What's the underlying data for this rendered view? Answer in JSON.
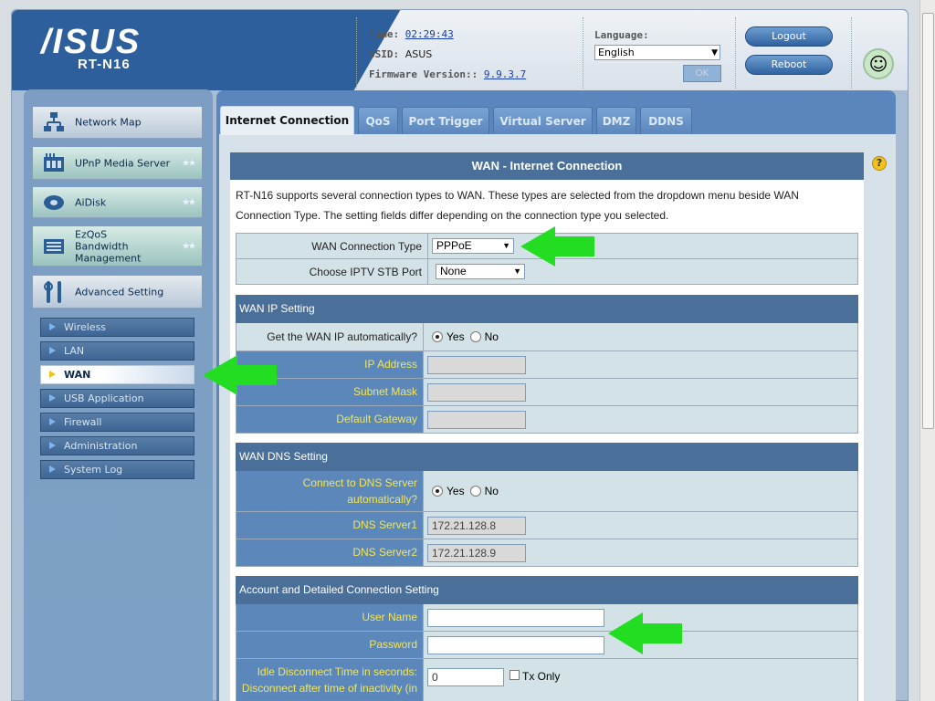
{
  "header": {
    "logo": "/ISUS",
    "model": "RT-N16",
    "time_label": "Time:",
    "time_value": "02:29:43",
    "ssid_label": "SSID:",
    "ssid_value": "ASUS",
    "firmware_label": "Firmware Version::",
    "firmware_value": "9.9.3.7",
    "language_label": "Language:",
    "language_value": "English",
    "ok_label": "OK",
    "logout_label": "Logout",
    "reboot_label": "Reboot"
  },
  "sidebar": {
    "main_items": [
      {
        "label": "Network Map"
      },
      {
        "label": "UPnP Media Server"
      },
      {
        "label": "AiDisk"
      },
      {
        "label": "EzQoS Bandwidth Management"
      },
      {
        "label": "Advanced Setting"
      }
    ],
    "sub_items": [
      {
        "label": "Wireless"
      },
      {
        "label": "LAN"
      },
      {
        "label": "WAN"
      },
      {
        "label": "USB Application"
      },
      {
        "label": "Firewall"
      },
      {
        "label": "Administration"
      },
      {
        "label": "System Log"
      }
    ]
  },
  "tabs": [
    "Internet Connection",
    "QoS",
    "Port Trigger",
    "Virtual Server",
    "DMZ",
    "DDNS"
  ],
  "panel": {
    "title": "WAN - Internet Connection",
    "description": "RT-N16 supports several connection types to WAN. These types are selected from the dropdown menu beside WAN Connection Type. The setting fields differ depending on the connection type you selected.",
    "wan_connection_type_label": "WAN Connection Type",
    "wan_connection_type_value": "PPPoE",
    "iptv_label": "Choose IPTV STB Port",
    "iptv_value": "None",
    "wan_ip_section": "WAN IP Setting",
    "get_ip_auto_label": "Get the WAN IP automatically?",
    "yes_label": "Yes",
    "no_label": "No",
    "ip_address_label": "IP Address",
    "subnet_mask_label": "Subnet Mask",
    "default_gateway_label": "Default Gateway",
    "wan_dns_section": "WAN DNS Setting",
    "dns_auto_label": "Connect to DNS Server automatically?",
    "dns_server1_label": "DNS Server1",
    "dns_server1_value": "172.21.128.8",
    "dns_server2_label": "DNS Server2",
    "dns_server2_value": "172.21.128.9",
    "account_section": "Account and Detailed Connection Setting",
    "username_label": "User Name",
    "password_label": "Password",
    "idle_label": "Idle Disconnect Time in seconds: Disconnect after time of inactivity (in",
    "idle_value": "0",
    "tx_only_label": "Tx Only"
  },
  "colors": {
    "arrow": "#22dd22",
    "header_blue": "#2d5f9c",
    "section_blue": "#4a6f99"
  }
}
